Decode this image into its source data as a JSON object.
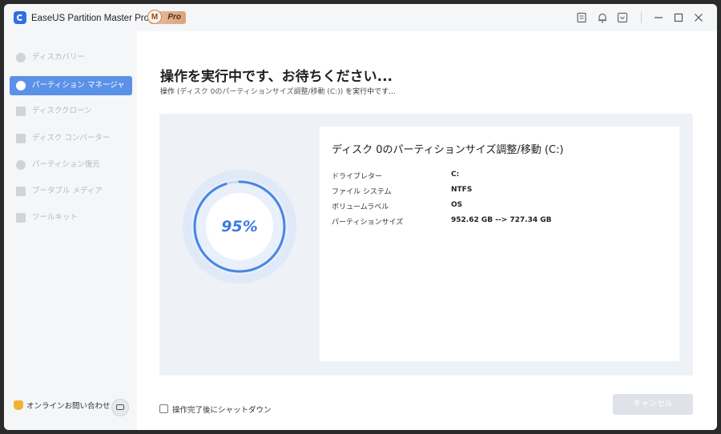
{
  "app": {
    "title": "EaseUS Partition Master Pro版",
    "badge_letter": "M",
    "badge_label": "Pro"
  },
  "titlebar_icons": [
    "notes-icon",
    "bell-icon",
    "dropdown-box-icon",
    "minimize-icon",
    "maximize-icon",
    "close-icon"
  ],
  "sidebar": {
    "items": [
      {
        "label": "ディスカバリー",
        "icon": "compass-icon",
        "active": false
      },
      {
        "label": "パーティション マネージャー",
        "icon": "pie-chart-icon",
        "active": true
      },
      {
        "label": "ディスククローン",
        "icon": "disk-clone-icon",
        "active": false
      },
      {
        "label": "ディスク コンバーター",
        "icon": "disk-converter-icon",
        "active": false
      },
      {
        "label": "パーティション復元",
        "icon": "partition-recovery-icon",
        "active": false
      },
      {
        "label": "ブータブル メディア",
        "icon": "bootable-media-icon",
        "active": false
      },
      {
        "label": "ツールキット",
        "icon": "toolkit-icon",
        "active": false
      }
    ],
    "contact_label": "オンラインお問い合わせ"
  },
  "main": {
    "heading": "操作を実行中です、お待ちください...",
    "sub_prefix": "操作 ",
    "sub_operation": "(ディスク 0のパーティションサイズ調整/移動 (C:))",
    "sub_suffix": " を実行中です...",
    "progress_label": "95%",
    "progress_value": 95,
    "info": {
      "title": "ディスク 0のパーティションサイズ調整/移動 (C:)",
      "rows": [
        {
          "label": "ドライブレター",
          "value": "C:"
        },
        {
          "label": "ファイル システム",
          "value": "NTFS"
        },
        {
          "label": "ボリュームラベル",
          "value": "OS"
        },
        {
          "label": "パーティションサイズ",
          "value": "952.62 GB --> 727.34 GB"
        }
      ]
    },
    "shutdown_label": "操作完了後にシャットダウン",
    "cancel_label": "キャンセル"
  },
  "colors": {
    "accent": "#5b91e8",
    "progress": "#3d7be0",
    "panel": "#eef1f6"
  }
}
